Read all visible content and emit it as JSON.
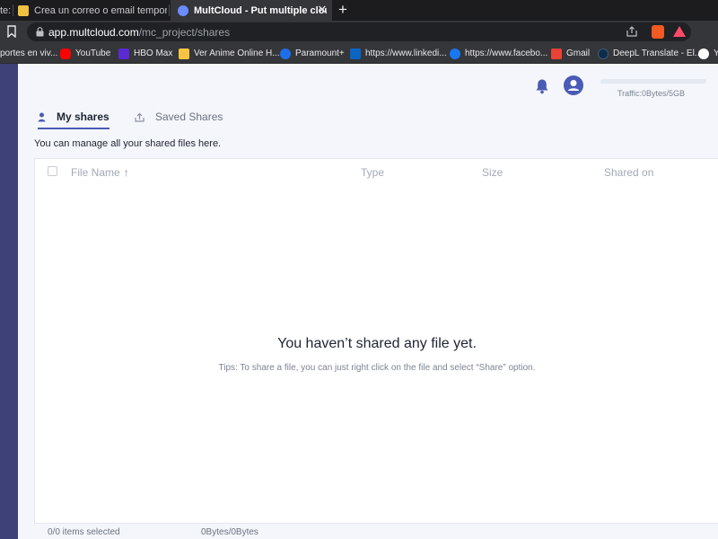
{
  "browser": {
    "tabs": [
      {
        "title": "te:",
        "favicon": "generic-tab-icon"
      },
      {
        "title": "Crea un correo o email temporal para",
        "favicon": "mail-icon"
      },
      {
        "title": "MultCloud - Put multiple cloud d",
        "favicon": "multcloud-icon",
        "active": true
      }
    ],
    "url_host": "app.multcloud.com",
    "url_path": "/mc_project/shares",
    "bookmarks": [
      {
        "label": "portes en viv...",
        "icon": "generic-bookmark-icon"
      },
      {
        "label": "YouTube",
        "icon": "youtube-icon",
        "color": "#ff0000"
      },
      {
        "label": "HBO Max",
        "icon": "hbomax-icon",
        "color": "#5b2bd1"
      },
      {
        "label": "Ver Anime Online H...",
        "icon": "anime-icon",
        "color": "#f5c542"
      },
      {
        "label": "Paramount+",
        "icon": "paramount-icon",
        "color": "#1f6feb"
      },
      {
        "label": "https://www.linkedi...",
        "icon": "linkedin-icon",
        "color": "#0a66c2"
      },
      {
        "label": "https://www.facebo...",
        "icon": "facebook-icon",
        "color": "#1877f2"
      },
      {
        "label": "Gmail",
        "icon": "gmail-icon",
        "color": "#ea4335"
      },
      {
        "label": "DeepL Translate - El...",
        "icon": "deepl-icon",
        "color": "#0f2b46"
      },
      {
        "label": "Y",
        "icon": "github-icon",
        "color": "#ffffff"
      }
    ]
  },
  "header": {
    "traffic": "Traffic:0Bytes/5GB",
    "traffic_used_fraction": 0
  },
  "tabs": {
    "my_shares": "My shares",
    "saved_shares": "Saved Shares"
  },
  "description": "You can manage all your shared files here.",
  "table": {
    "columns": [
      "File Name",
      "Type",
      "Size",
      "Shared on"
    ]
  },
  "empty_state": {
    "title": "You haven’t shared any file yet.",
    "tip": "Tips: To share a file, you can just right click on the file and select “Share” option."
  },
  "footer": {
    "selected": "0/0 items selected",
    "size": "0Bytes/0Bytes"
  },
  "colors": {
    "accent": "#4a5bb5",
    "sidebar": "#3d4177"
  }
}
